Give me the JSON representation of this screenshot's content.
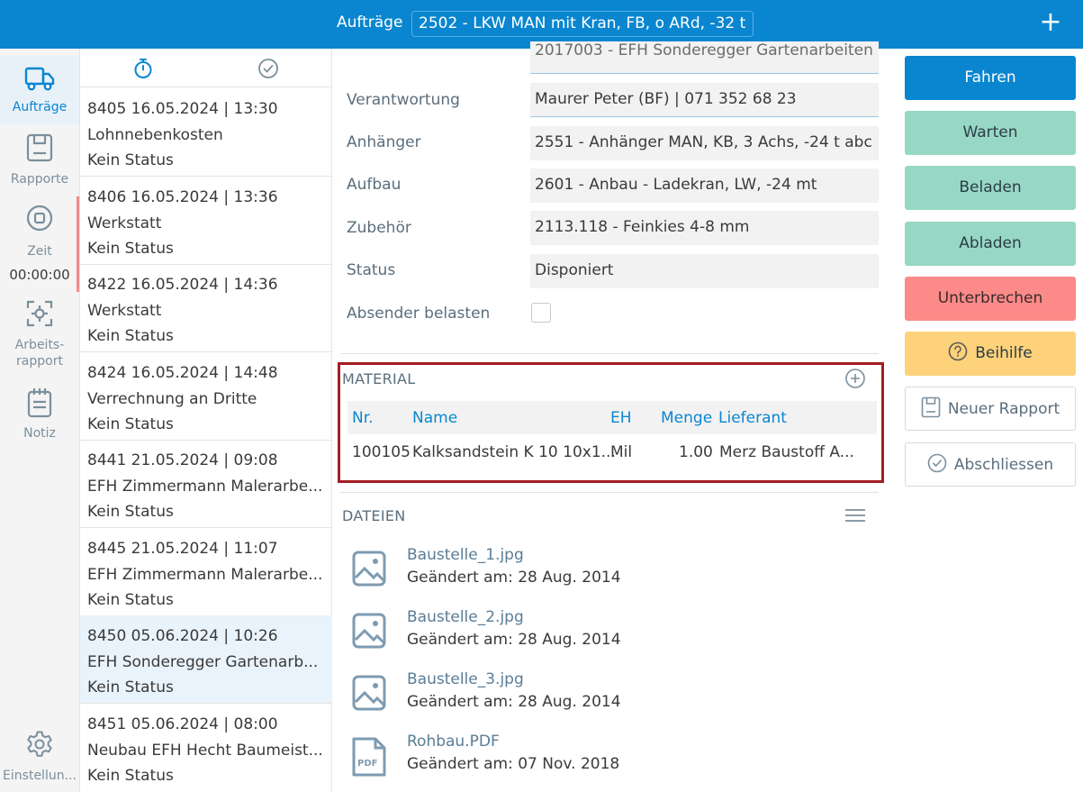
{
  "topbar": {
    "label": "Aufträge",
    "truck": "2502 - LKW MAN mit Kran, FB, o ARd, -32 t",
    "add_icon": "plus-icon"
  },
  "nav": {
    "items": [
      {
        "label": "Aufträge",
        "icon": "truck-icon",
        "active": true
      },
      {
        "label": "Rapporte",
        "icon": "report-icon"
      },
      {
        "label": "Zeit",
        "icon": "stop-timer-icon"
      },
      {
        "label_line1": "Arbeits-",
        "label_line2": "rapport",
        "icon": "scan-focus-icon"
      },
      {
        "label": "Notiz",
        "icon": "notepad-icon"
      },
      {
        "label": "Einstellun...",
        "icon": "gear-icon"
      }
    ],
    "time": "00:00:00"
  },
  "list": {
    "tabs": [
      {
        "icon": "stopwatch-icon"
      },
      {
        "icon": "check-circle-icon"
      }
    ],
    "orders": [
      {
        "head": "8405  16.05.2024 | 13:30",
        "title": "Lohnnebenkosten",
        "status": "Kein Status"
      },
      {
        "head": "8406  16.05.2024 | 13:36",
        "title": "Werkstatt",
        "status": "Kein Status"
      },
      {
        "head": "8422  16.05.2024 | 14:36",
        "title": "Werkstatt",
        "status": "Kein Status"
      },
      {
        "head": "8424  16.05.2024 | 14:48",
        "title": "Verrechnung an Dritte",
        "status": "Kein Status"
      },
      {
        "head": "8441  21.05.2024 | 09:08",
        "title": "EFH Zimmermann Malerarbe...",
        "status": "Kein Status"
      },
      {
        "head": "8445  21.05.2024 | 11:07",
        "title": "EFH Zimmermann Malerarbe...",
        "status": "Kein Status"
      },
      {
        "head": "8450  05.06.2024 | 10:26",
        "title": "EFH Sonderegger Gartenarb...",
        "status": "Kein Status"
      },
      {
        "head": "8451  05.06.2024 | 08:00",
        "title": "Neubau EFH Hecht Baumeist...",
        "status": "Kein Status"
      }
    ]
  },
  "detail": {
    "project_partial": "2017003 - EFH Sonderegger Gartenarbeiten",
    "fields": [
      {
        "label": "Verantwortung",
        "value": "Maurer Peter (BF) | 071 352 68 23"
      },
      {
        "label": "Anhänger",
        "value": "2551 - Anhänger MAN, KB, 3 Achs, -24 t abc"
      },
      {
        "label": "Aufbau",
        "value": "2601 - Anbau - Ladekran, LW, -24 mt"
      },
      {
        "label": "Zubehör",
        "value": "2113.118 - Feinkies 4-8 mm"
      },
      {
        "label": "Status",
        "value": "Disponiert"
      }
    ],
    "absender_label": "Absender belasten",
    "material": {
      "title": "MATERIAL",
      "columns": {
        "nr": "Nr.",
        "name": "Name",
        "eh": "EH",
        "menge": "Menge",
        "lieferant": "Lieferant"
      },
      "rows": [
        {
          "nr": "100105",
          "name": "Kalksandstein K 10 10x1...",
          "eh": "Mil",
          "menge": "1.00",
          "lieferant": "Merz Baustoff A..."
        }
      ]
    },
    "dateien": {
      "title": "DATEIEN",
      "files": [
        {
          "name": "Baustelle_1.jpg",
          "date": "Geändert am: 28 Aug. 2014",
          "icon": "image-file-icon"
        },
        {
          "name": "Baustelle_2.jpg",
          "date": "Geändert am: 28 Aug. 2014",
          "icon": "image-file-icon"
        },
        {
          "name": "Baustelle_3.jpg",
          "date": "Geändert am: 28 Aug. 2014",
          "icon": "image-file-icon"
        },
        {
          "name": "Rohbau.PDF",
          "date": "Geändert am: 07 Nov. 2018",
          "icon": "pdf-file-icon",
          "icon_text": "PDF"
        }
      ]
    }
  },
  "actions": {
    "fahren": "Fahren",
    "warten": "Warten",
    "beladen": "Beladen",
    "abladen": "Abladen",
    "unterbrechen": "Unterbrechen",
    "beihilfe": "Beihilfe",
    "neuer_rapport": "Neuer Rapport",
    "abschliessen": "Abschliessen"
  },
  "colors": {
    "accent": "#0a86d0",
    "green": "#97d8c4",
    "red": "#fb8a88",
    "yellow": "#fdd27a",
    "highlight_border": "#a31d24"
  }
}
